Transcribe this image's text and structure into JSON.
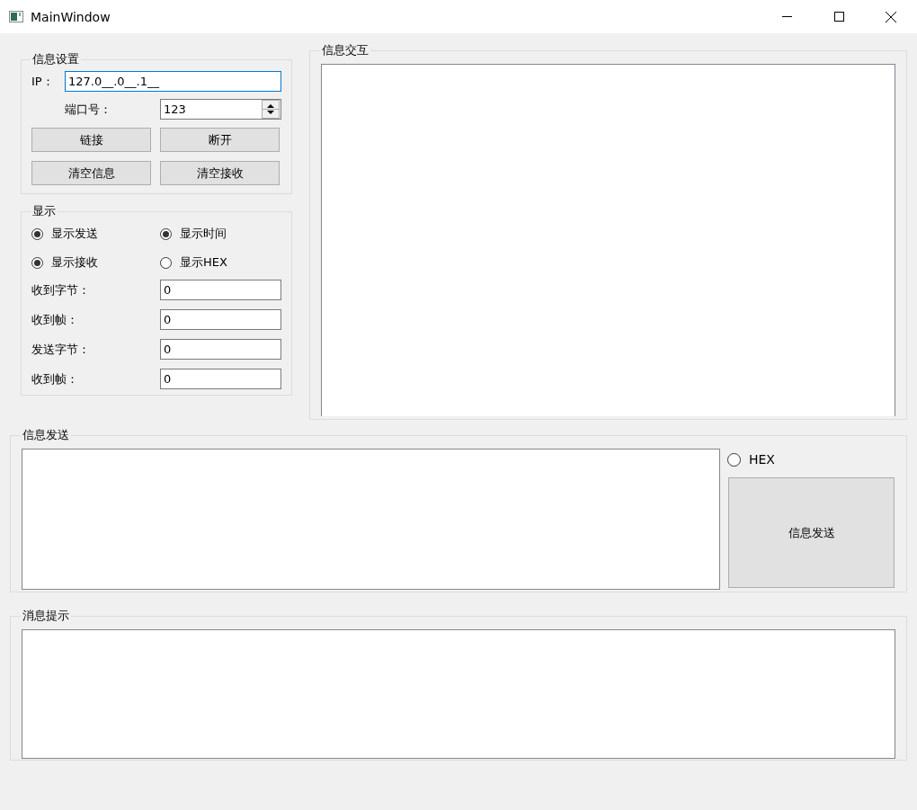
{
  "window": {
    "title": "MainWindow"
  },
  "settings": {
    "title": "信息设置",
    "ip_label": "IP：",
    "ip_value": "127.0__.0__.1__",
    "port_label": "端口号：",
    "port_value": "123",
    "buttons": [
      "链接",
      "断开",
      "清空信息",
      "清空接收"
    ]
  },
  "display": {
    "title": "显示",
    "options": [
      {
        "label": "显示发送",
        "checked": true
      },
      {
        "label": "显示时间",
        "checked": true
      },
      {
        "label": "显示接收",
        "checked": true
      },
      {
        "label": "显示HEX",
        "checked": false
      }
    ],
    "counters": [
      {
        "label": "收到字节：",
        "value": "0"
      },
      {
        "label": "收到帧：",
        "value": "0"
      },
      {
        "label": "发送字节：",
        "value": "0"
      },
      {
        "label": "收到帧：",
        "value": "0"
      }
    ]
  },
  "interaction": {
    "title": "信息交互"
  },
  "send": {
    "title": "信息发送",
    "hex": {
      "label": "HEX",
      "checked": false
    },
    "button": "信息发送"
  },
  "hints": {
    "title": "消息提示"
  }
}
